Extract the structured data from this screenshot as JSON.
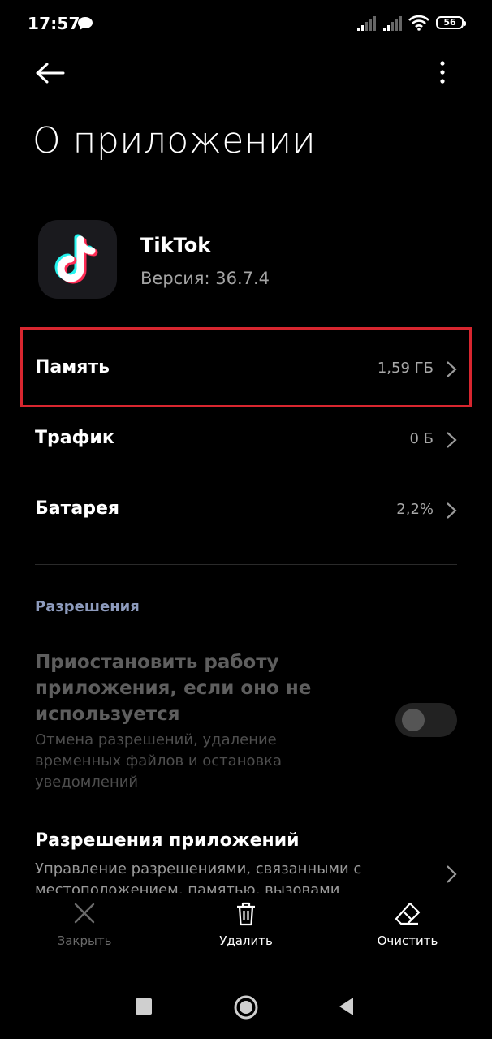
{
  "status_bar": {
    "time": "17:57",
    "battery_level": "56",
    "icons": [
      "chat-bubble-icon",
      "signal-icon",
      "signal-icon",
      "wifi-icon",
      "battery-icon"
    ]
  },
  "header": {
    "back_icon": "arrow-left-icon",
    "more_icon": "more-vertical-icon",
    "title": "О приложении"
  },
  "app": {
    "icon": "tiktok-logo",
    "name": "TikTok",
    "version": "Версия: 36.7.4"
  },
  "usage_rows": [
    {
      "label": "Память",
      "value": "1,59 ГБ"
    },
    {
      "label": "Трафик",
      "value": "0 Б"
    },
    {
      "label": "Батарея",
      "value": "2,2%"
    }
  ],
  "permissions": {
    "section_title": "Разрешения",
    "pause_title": "Приостановить работу приложения, если оно не используется",
    "pause_subtitle": "Отмена разрешений, удаление временных файлов и остановка уведомлений",
    "pause_toggle_on": false,
    "app_perms_title": "Разрешения приложений",
    "app_perms_subtitle": "Управление разрешениями, связанными с местоположением, памятью, вызовами"
  },
  "actions": {
    "close_label": "Закрыть",
    "delete_label": "Удалить",
    "clear_label": "Очистить"
  },
  "colors": {
    "highlight": "#d8262f",
    "section_header": "#8d9bbd",
    "background": "#000000"
  }
}
